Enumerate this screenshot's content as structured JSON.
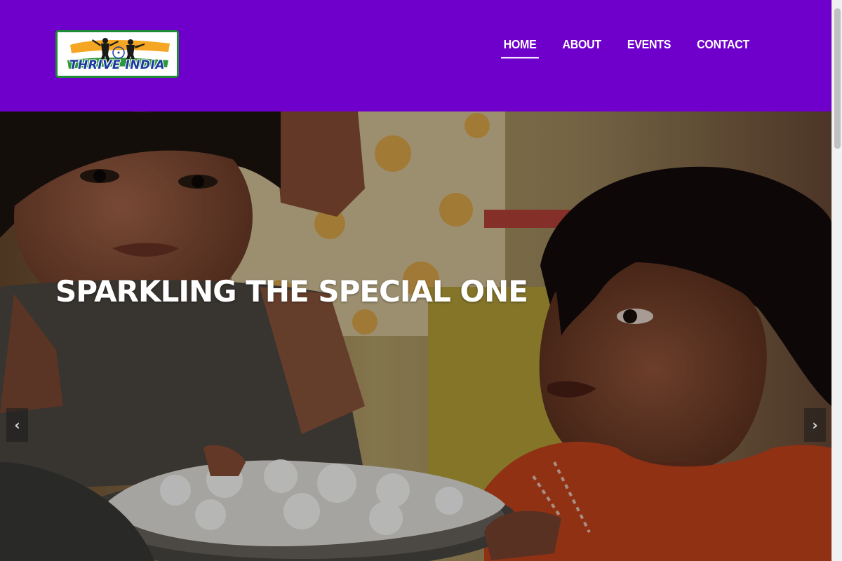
{
  "header": {
    "logo_text": "THRIVE INDIA",
    "nav": [
      {
        "label": "HOME",
        "active": true
      },
      {
        "label": "ABOUT",
        "active": false
      },
      {
        "label": "EVENTS",
        "active": false
      },
      {
        "label": "CONTACT",
        "active": false
      }
    ]
  },
  "hero": {
    "title": "SPARKLING THE SPECIAL ONE",
    "prev_icon": "‹",
    "next_icon": "›"
  },
  "colors": {
    "header_bg": "#6f00cc",
    "logo_border": "#1f8a3a",
    "logo_text": "#1a3a9e",
    "flag_saffron": "#f5a623",
    "flag_green": "#2a9a3a",
    "chakra": "#1a3a9e"
  }
}
